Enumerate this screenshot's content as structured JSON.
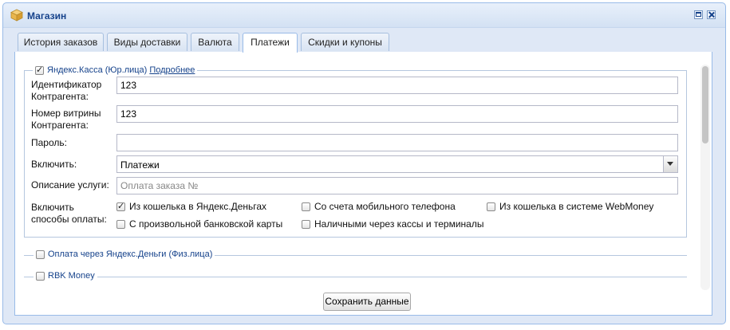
{
  "window": {
    "title": "Магазин"
  },
  "tabs": [
    {
      "label": "История заказов",
      "active": false
    },
    {
      "label": "Виды доставки",
      "active": false
    },
    {
      "label": "Валюта",
      "active": false
    },
    {
      "label": "Платежи",
      "active": true
    },
    {
      "label": "Скидки и купоны",
      "active": false
    }
  ],
  "yandex_kassa": {
    "legend": "Яндекс.Касса (Юр.лица)",
    "link": "Подробнее",
    "checked": true,
    "fields": {
      "contractor_id_label_1": "Идентификатор",
      "contractor_id_label_2": "Контрагента:",
      "contractor_id_value": "123",
      "showcase_label_1": "Номер витрины",
      "showcase_label_2": "Контрагента:",
      "showcase_value": "123",
      "password_label": "Пароль:",
      "password_value": "",
      "enable_label": "Включить:",
      "enable_value": "Платежи",
      "description_label": "Описание услуги:",
      "description_placeholder": "Оплата заказа №",
      "methods_label_1": "Включить",
      "methods_label_2": "способы оплаты:"
    },
    "methods": [
      {
        "label": "Из кошелька в Яндекс.Деньгах",
        "checked": true
      },
      {
        "label": "Со счета мобильного телефона",
        "checked": false
      },
      {
        "label": "Из кошелька в системе WebMoney",
        "checked": false
      },
      {
        "label": "С произвольной банковской карты",
        "checked": false
      },
      {
        "label": "Наличными через кассы и терминалы",
        "checked": false
      }
    ]
  },
  "sections": [
    {
      "label": "Оплата через Яндекс.Деньги (Физ.лица)",
      "checked": false
    },
    {
      "label": "RBK Money",
      "checked": false
    }
  ],
  "save_button": "Сохранить данные"
}
